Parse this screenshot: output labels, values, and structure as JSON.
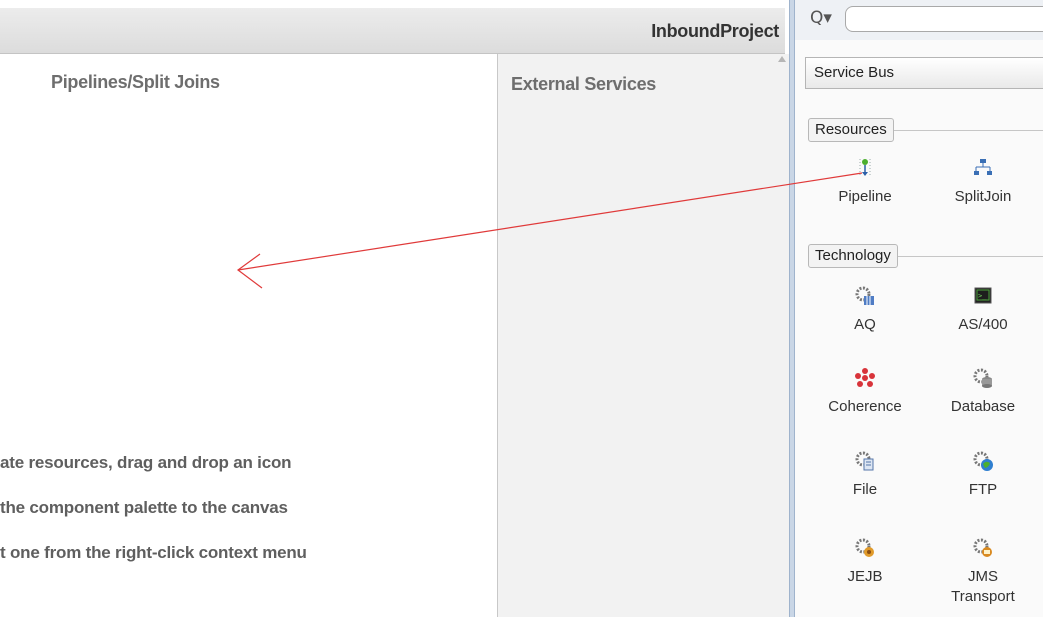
{
  "editor": {
    "project_title": "InboundProject",
    "lanes": {
      "pipelines_title": "Pipelines/Split Joins",
      "external_title": "External Services"
    },
    "hint_lines": [
      "ate resources, drag and drop an icon",
      "the component palette to the canvas",
      "t one from the right-click context menu"
    ]
  },
  "palette": {
    "search_icon": "Q▾",
    "search_value": "",
    "category": "Service Bus",
    "groups": {
      "resources": {
        "title": "Resources",
        "items": [
          {
            "label": "Pipeline",
            "icon": "pipeline-icon"
          },
          {
            "label": "SplitJoin",
            "icon": "splitjoin-icon"
          }
        ]
      },
      "technology": {
        "title": "Technology",
        "items": [
          {
            "label": "AQ",
            "icon": "aq-icon"
          },
          {
            "label": "AS/400",
            "icon": "as400-icon"
          },
          {
            "label": "Coherence",
            "icon": "coherence-icon"
          },
          {
            "label": "Database",
            "icon": "database-icon"
          },
          {
            "label": "File",
            "icon": "file-icon"
          },
          {
            "label": "FTP",
            "icon": "ftp-icon"
          },
          {
            "label": "JEJB",
            "icon": "jejb-icon"
          },
          {
            "label": "JMS\nTransport",
            "icon": "jms-transport-icon"
          }
        ]
      }
    }
  },
  "colors": {
    "drag_arrow": "#e03a3a",
    "pane_divider": "#c9d6e6"
  }
}
